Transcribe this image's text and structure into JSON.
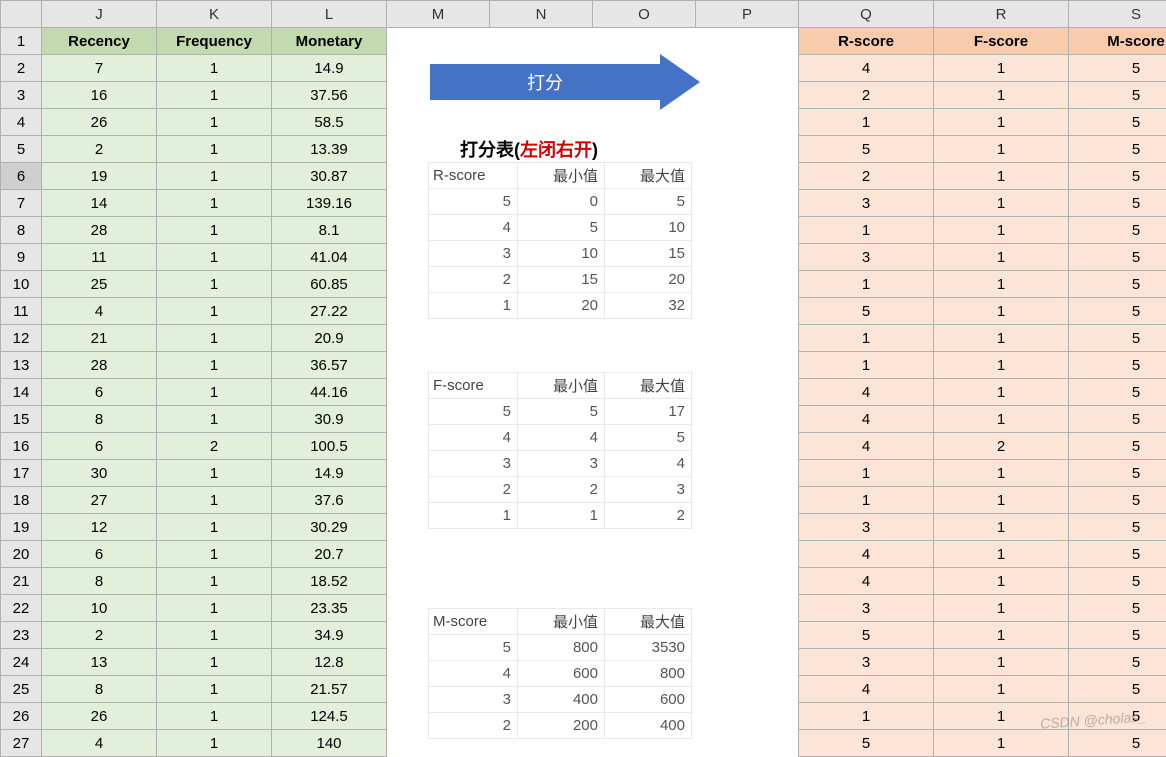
{
  "colHeaders": [
    "J",
    "K",
    "L",
    "M",
    "N",
    "O",
    "P",
    "Q",
    "R",
    "S"
  ],
  "rfmHeaders": [
    "Recency",
    "Frequency",
    "Monetary"
  ],
  "scoreHeaders": [
    "R-score",
    "F-score",
    "M-score"
  ],
  "arrowLabel": "打分",
  "scoringTableTitle": {
    "prefix": "打分表(",
    "mid": "左闭右开",
    "suffix": ")"
  },
  "scoringHeader": {
    "min": "最小值",
    "max": "最大值"
  },
  "watermark": "CSDN @cholas_",
  "rows": [
    {
      "n": 1
    },
    {
      "n": 2,
      "rfm": [
        7,
        1,
        14.9
      ],
      "score": [
        4,
        1,
        5
      ]
    },
    {
      "n": 3,
      "rfm": [
        16,
        1,
        37.56
      ],
      "score": [
        2,
        1,
        5
      ]
    },
    {
      "n": 4,
      "rfm": [
        26,
        1,
        58.5
      ],
      "score": [
        1,
        1,
        5
      ]
    },
    {
      "n": 5,
      "rfm": [
        2,
        1,
        13.39
      ],
      "score": [
        5,
        1,
        5
      ]
    },
    {
      "n": 6,
      "rfm": [
        19,
        1,
        30.87
      ],
      "score": [
        2,
        1,
        5
      ],
      "selected": true
    },
    {
      "n": 7,
      "rfm": [
        14,
        1,
        139.16
      ],
      "score": [
        3,
        1,
        5
      ]
    },
    {
      "n": 8,
      "rfm": [
        28,
        1,
        8.1
      ],
      "score": [
        1,
        1,
        5
      ]
    },
    {
      "n": 9,
      "rfm": [
        11,
        1,
        41.04
      ],
      "score": [
        3,
        1,
        5
      ]
    },
    {
      "n": 10,
      "rfm": [
        25,
        1,
        60.85
      ],
      "score": [
        1,
        1,
        5
      ]
    },
    {
      "n": 11,
      "rfm": [
        4,
        1,
        27.22
      ],
      "score": [
        5,
        1,
        5
      ]
    },
    {
      "n": 12,
      "rfm": [
        21,
        1,
        20.9
      ],
      "score": [
        1,
        1,
        5
      ]
    },
    {
      "n": 13,
      "rfm": [
        28,
        1,
        36.57
      ],
      "score": [
        1,
        1,
        5
      ]
    },
    {
      "n": 14,
      "rfm": [
        6,
        1,
        44.16
      ],
      "score": [
        4,
        1,
        5
      ]
    },
    {
      "n": 15,
      "rfm": [
        8,
        1,
        30.9
      ],
      "score": [
        4,
        1,
        5
      ]
    },
    {
      "n": 16,
      "rfm": [
        6,
        2,
        100.5
      ],
      "score": [
        4,
        2,
        5
      ]
    },
    {
      "n": 17,
      "rfm": [
        30,
        1,
        14.9
      ],
      "score": [
        1,
        1,
        5
      ]
    },
    {
      "n": 18,
      "rfm": [
        27,
        1,
        37.6
      ],
      "score": [
        1,
        1,
        5
      ]
    },
    {
      "n": 19,
      "rfm": [
        12,
        1,
        30.29
      ],
      "score": [
        3,
        1,
        5
      ]
    },
    {
      "n": 20,
      "rfm": [
        6,
        1,
        20.7
      ],
      "score": [
        4,
        1,
        5
      ]
    },
    {
      "n": 21,
      "rfm": [
        8,
        1,
        18.52
      ],
      "score": [
        4,
        1,
        5
      ]
    },
    {
      "n": 22,
      "rfm": [
        10,
        1,
        23.35
      ],
      "score": [
        3,
        1,
        5
      ]
    },
    {
      "n": 23,
      "rfm": [
        2,
        1,
        34.9
      ],
      "score": [
        5,
        1,
        5
      ]
    },
    {
      "n": 24,
      "rfm": [
        13,
        1,
        12.8
      ],
      "score": [
        3,
        1,
        5
      ]
    },
    {
      "n": 25,
      "rfm": [
        8,
        1,
        21.57
      ],
      "score": [
        4,
        1,
        5
      ]
    },
    {
      "n": 26,
      "rfm": [
        26,
        1,
        124.5
      ],
      "score": [
        1,
        1,
        5
      ]
    },
    {
      "n": 27,
      "rfm": [
        4,
        1,
        140
      ],
      "score": [
        5,
        1,
        5
      ]
    }
  ],
  "rScoreTable": {
    "label": "R-score",
    "rows": [
      [
        5,
        0,
        5
      ],
      [
        4,
        5,
        10
      ],
      [
        3,
        10,
        15
      ],
      [
        2,
        15,
        20
      ],
      [
        1,
        20,
        32
      ]
    ]
  },
  "fScoreTable": {
    "label": "F-score",
    "rows": [
      [
        5,
        5,
        17
      ],
      [
        4,
        4,
        5
      ],
      [
        3,
        3,
        4
      ],
      [
        2,
        2,
        3
      ],
      [
        1,
        1,
        2
      ]
    ]
  },
  "mScoreTable": {
    "label": "M-score",
    "rows": [
      [
        5,
        800,
        3530
      ],
      [
        4,
        600,
        800
      ],
      [
        3,
        400,
        600
      ],
      [
        2,
        200,
        400
      ]
    ]
  }
}
